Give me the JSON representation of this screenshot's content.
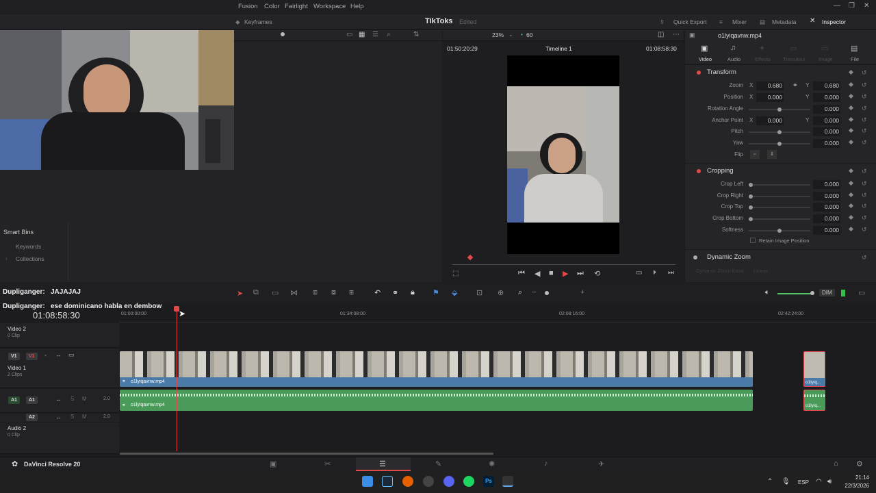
{
  "menu": {
    "items": [
      "Fusion",
      "Color",
      "Fairlight",
      "Workspace",
      "Help"
    ]
  },
  "toolbar": {
    "keyframes": "Keyframes",
    "project_title": "TikToks",
    "edited": "Edited",
    "quick_export": "Quick Export",
    "mixer": "Mixer",
    "metadata": "Metadata",
    "inspector": "Inspector"
  },
  "viewer": {
    "zoom": "23%",
    "fps": "60",
    "source_tc": "01:50:20:29",
    "timeline_name": "Timeline 1",
    "record_tc": "01:08:58:30"
  },
  "media": {
    "smart_bins": "Smart Bins",
    "keywords": "Keywords",
    "collections": "Collections"
  },
  "inspector": {
    "clip_name": "o1lyiqavnw.mp4",
    "tabs": [
      "Video",
      "Audio",
      "Effects",
      "Transition",
      "Image",
      "File"
    ],
    "transform": {
      "title": "Transform",
      "zoom_label": "Zoom",
      "zoom_x": "0.680",
      "zoom_y": "0.680",
      "position_label": "Position",
      "position_x": "0.000",
      "position_y": "0.000",
      "rotation_label": "Rotation Angle",
      "rotation": "0.000",
      "anchor_label": "Anchor Point",
      "anchor_x": "0.000",
      "anchor_y": "0.000",
      "pitch_label": "Pitch",
      "pitch": "0.000",
      "yaw_label": "Yaw",
      "yaw": "0.000",
      "flip_label": "Flip"
    },
    "cropping": {
      "title": "Cropping",
      "left_label": "Crop Left",
      "left": "0.000",
      "right_label": "Crop Right",
      "right": "0.000",
      "top_label": "Crop Top",
      "top": "0.000",
      "bottom_label": "Crop Bottom",
      "bottom": "0.000",
      "softness_label": "Softness",
      "softness": "0.000",
      "retain": "Retain Image Position"
    },
    "dynamic_zoom": {
      "title": "Dynamic Zoom",
      "ease_label": "Dynamic Zoom Ease",
      "ease": "Linear"
    }
  },
  "chat": {
    "line1_user": "Dupliganger:",
    "line1_msg": "JAJAJAJ",
    "line2_user": "Dupliganger:",
    "line2_msg": "ese dominicano habla en dembow"
  },
  "timeline": {
    "timecode": "01:08:58:30",
    "dim": "DIM",
    "ruler": [
      "01:00:00:00",
      "01:34:08:00",
      "02:08:16:00",
      "02:42:24:00"
    ],
    "tracks": {
      "v2_name": "Video 2",
      "v2_clips": "0 Clip",
      "v1_name": "Video 1",
      "v1_clips": "2 Clips",
      "a1_vol": "2.0",
      "a2_vol": "2.0",
      "audio2_name": "Audio 2",
      "audio2_clips": "0 Clip",
      "v1": "V1",
      "a1": "A1",
      "a2": "A2"
    },
    "clip_name": "o1lyiqavnw.mp4",
    "clip_short": "o1lyiq..."
  },
  "status": {
    "app_name": "DaVinci Resolve 20"
  },
  "taskbar": {
    "lang": "ESP",
    "time": "21:14",
    "date": "22/3/2026"
  },
  "colors": {
    "accent_red": "#e04a4a",
    "audio_green": "#4a9a5a",
    "video_blue": "#4a7aa8"
  }
}
